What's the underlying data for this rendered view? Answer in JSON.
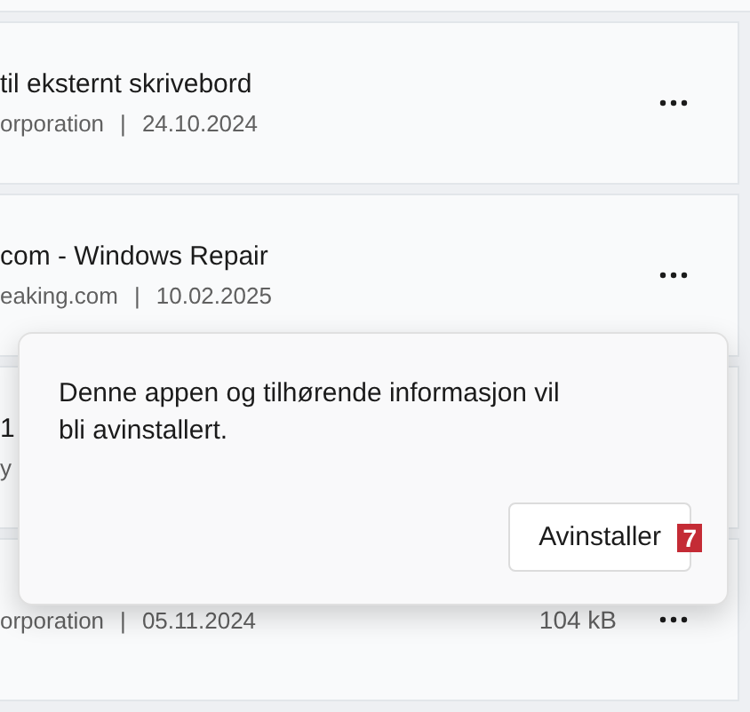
{
  "apps": [
    {
      "title": "til eksternt skrivebord",
      "publisher": "orporation",
      "separator": "|",
      "date": "24.10.2024"
    },
    {
      "title": "com - Windows Repair",
      "publisher": "eaking.com",
      "separator": "|",
      "date": "10.02.2025"
    },
    {
      "title": "1",
      "publisher": "y"
    },
    {
      "publisher": "orporation",
      "separator": "|",
      "date": "05.11.2024",
      "size": "104 kB"
    }
  ],
  "dialog": {
    "message": "Denne appen og tilhørende informasjon vil bli avinstallert.",
    "button": "Avinstaller",
    "step_badge": "7"
  }
}
